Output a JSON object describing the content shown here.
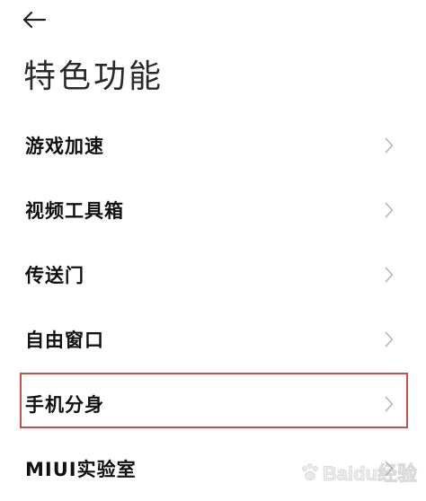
{
  "header": {
    "back_icon": "arrow-left-icon",
    "title": "特色功能"
  },
  "menu": {
    "items": [
      {
        "label": "游戏加速",
        "icon": "chevron-right-icon"
      },
      {
        "label": "视频工具箱",
        "icon": "chevron-right-icon"
      },
      {
        "label": "传送门",
        "icon": "chevron-right-icon"
      },
      {
        "label": "自由窗口",
        "icon": "chevron-right-icon"
      },
      {
        "label": "手机分身",
        "icon": "chevron-right-icon",
        "highlighted": true
      },
      {
        "label": "MIUI实验室",
        "icon": "chevron-right-icon"
      }
    ]
  },
  "watermark": {
    "text": "Baidu经验"
  },
  "colors": {
    "text": "#111111",
    "chevron": "#b5b5b5",
    "highlight_border": "#c8504a",
    "background": "#ffffff"
  }
}
